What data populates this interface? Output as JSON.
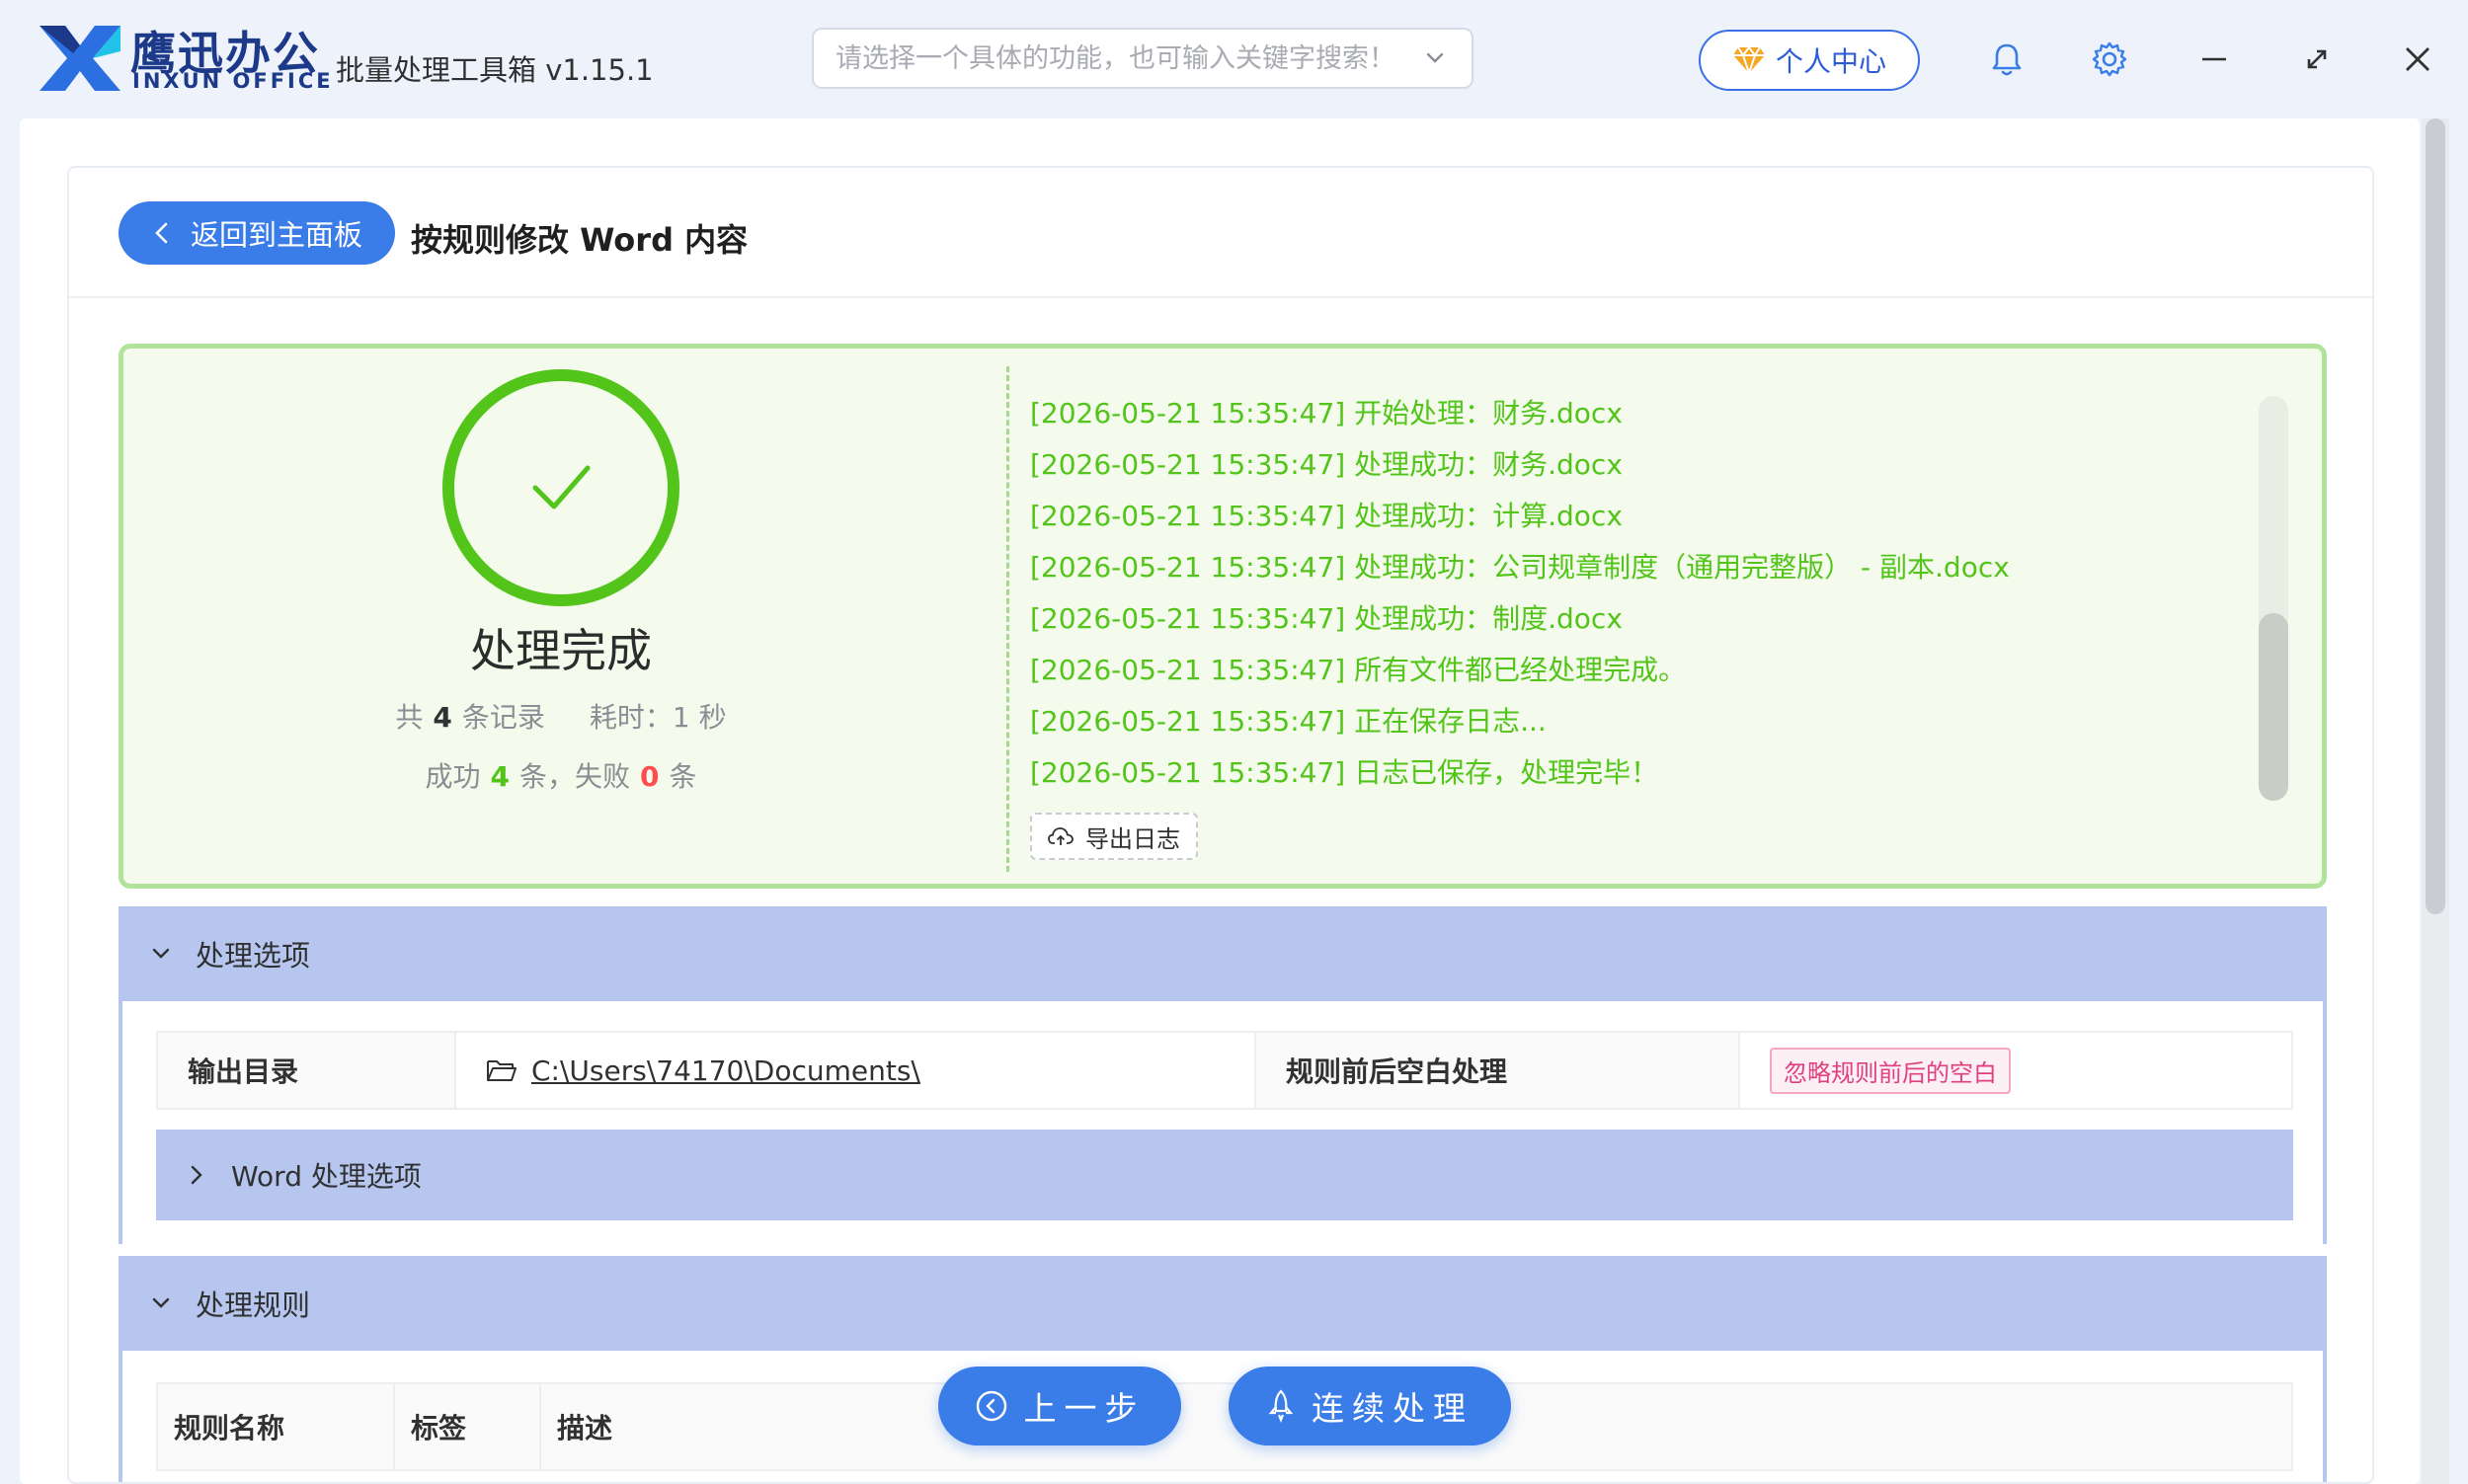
{
  "app": {
    "brand_cn": "鹰迅办公",
    "brand_en": "INXUN OFFICE",
    "title": "批量处理工具箱 v1.15.1",
    "search_placeholder": "请选择一个具体的功能，也可输入关键字搜索！",
    "user_center_label": "个人中心"
  },
  "page": {
    "back_label": "返回到主面板",
    "title": "按规则修改 Word 内容"
  },
  "result": {
    "status": "处理完成",
    "total_prefix": "共",
    "total_count": "4",
    "total_suffix": "条记录",
    "time_prefix": "耗时：",
    "time_value": "1",
    "time_unit": "秒",
    "success_prefix": "成功",
    "success_count": "4",
    "success_suffix": "条，失败",
    "fail_count": "0",
    "fail_suffix": "条",
    "log": [
      "[2026-05-21 15:35:47] 开始处理：财务.docx",
      "[2026-05-21 15:35:47] 处理成功：财务.docx",
      "[2026-05-21 15:35:47] 处理成功：计算.docx",
      "[2026-05-21 15:35:47] 处理成功：公司规章制度（通用完整版） - 副本.docx",
      "[2026-05-21 15:35:47] 处理成功：制度.docx",
      "[2026-05-21 15:35:47] 所有文件都已经处理完成。",
      "[2026-05-21 15:35:47] 正在保存日志...",
      "[2026-05-21 15:35:47] 日志已保存，处理完毕！"
    ],
    "export_label": "导出日志"
  },
  "options": {
    "section_title": "处理选项",
    "output_dir_label": "输出目录",
    "output_dir_value": "C:\\Users\\74170\\Documents\\",
    "whitespace_label": "规则前后空白处理",
    "whitespace_value": "忽略规则前后的空白",
    "word_options_label": "Word 处理选项"
  },
  "rules": {
    "section_title": "处理规则",
    "columns": [
      "规则名称",
      "标签",
      "描述"
    ]
  },
  "actions": {
    "prev_label": "上一步",
    "continue_label": "连续处理"
  },
  "colors": {
    "primary": "#3a7ce8",
    "success": "#52c41a",
    "danger": "#ff4d4f",
    "section_bg": "#b7c6ee",
    "result_bg": "#f4fbec"
  }
}
